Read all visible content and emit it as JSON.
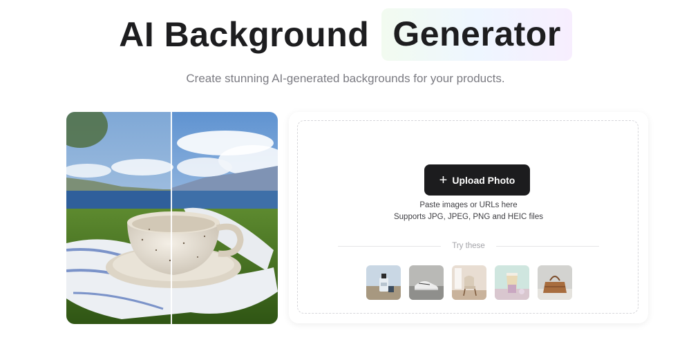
{
  "hero": {
    "title_part1": "AI Background",
    "title_part2": "Generator",
    "subtitle": "Create stunning AI-generated backgrounds for your products."
  },
  "upload": {
    "button_label": "Upload Photo",
    "button_icon": "plus-icon",
    "hint_line1": "Paste images or URLs here",
    "hint_line2": "Supports JPG, JPEG, PNG and HEIC files",
    "try_label": "Try these"
  },
  "samples": [
    {
      "name": "sample-perfume-bottle",
      "icon": "perfume-bottle"
    },
    {
      "name": "sample-sneakers",
      "icon": "sneakers"
    },
    {
      "name": "sample-chair",
      "icon": "chair"
    },
    {
      "name": "sample-drink-cup",
      "icon": "drink-cup"
    },
    {
      "name": "sample-handbag",
      "icon": "handbag"
    }
  ],
  "colors": {
    "button_bg": "#1c1c1e",
    "subtitle": "#7b7b82",
    "title_highlight": "#eef6ff"
  }
}
